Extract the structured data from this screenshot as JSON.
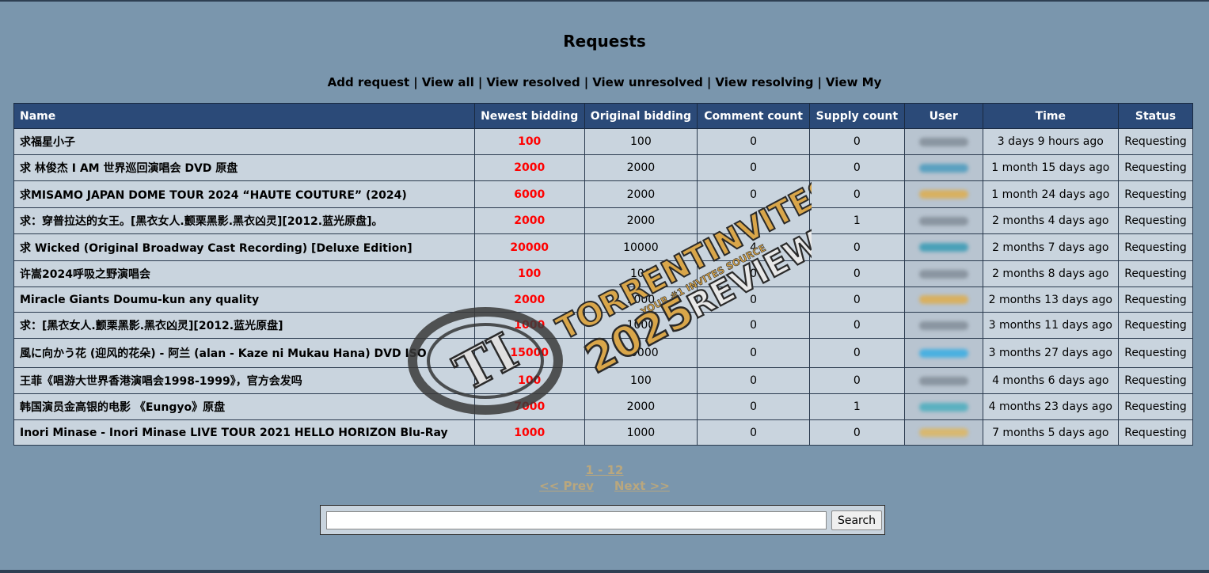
{
  "page": {
    "title": "Requests"
  },
  "nav": [
    {
      "label": "Add request"
    },
    {
      "label": "View all"
    },
    {
      "label": "View resolved"
    },
    {
      "label": "View unresolved"
    },
    {
      "label": "View resolving"
    },
    {
      "label": "View My"
    }
  ],
  "table": {
    "headers": {
      "name": "Name",
      "newest": "Newest bidding",
      "original": "Original bidding",
      "comments": "Comment count",
      "supply": "Supply count",
      "user": "User",
      "time": "Time",
      "status": "Status"
    },
    "rows": [
      {
        "name": "求福星小子",
        "newest": "100",
        "original": "100",
        "comments": "0",
        "supply": "0",
        "user_color": "#8a95a0",
        "time": "3 days 9 hours ago",
        "status": "Requesting"
      },
      {
        "name": "求 林俊杰 I AM 世界巡回演唱会 DVD 原盘",
        "newest": "2000",
        "original": "2000",
        "comments": "0",
        "supply": "0",
        "user_color": "#5aa0c0",
        "time": "1 month 15 days ago",
        "status": "Requesting"
      },
      {
        "name": "求MISAMO JAPAN DOME TOUR 2024 “HAUTE COUTURE” (2024)",
        "newest": "6000",
        "original": "2000",
        "comments": "0",
        "supply": "0",
        "user_color": "#d8b060",
        "time": "1 month 24 days ago",
        "status": "Requesting"
      },
      {
        "name": "求：穿普拉达的女王。[黑衣女人.颤栗黑影.黑衣凶灵][2012.蓝光原盘]。",
        "newest": "2000",
        "original": "2000",
        "comments": "0",
        "supply": "1",
        "user_color": "#8a95a0",
        "time": "2 months 4 days ago",
        "status": "Requesting"
      },
      {
        "name": "求 Wicked (Original Broadway Cast Recording) [Deluxe Edition]",
        "newest": "20000",
        "original": "10000",
        "comments": "4",
        "supply": "0",
        "user_color": "#4aa0b8",
        "time": "2 months 7 days ago",
        "status": "Requesting"
      },
      {
        "name": "许嵩2024呼吸之野演唱会",
        "newest": "100",
        "original": "100",
        "comments": "0",
        "supply": "0",
        "user_color": "#8a95a0",
        "time": "2 months 8 days ago",
        "status": "Requesting"
      },
      {
        "name": "Miracle Giants Doumu-kun any quality",
        "newest": "2000",
        "original": "1000",
        "comments": "0",
        "supply": "0",
        "user_color": "#d8b060",
        "time": "2 months 13 days ago",
        "status": "Requesting"
      },
      {
        "name": "求：[黑衣女人.颤栗黑影.黑衣凶灵][2012.蓝光原盘]",
        "newest": "1000",
        "original": "1000",
        "comments": "0",
        "supply": "0",
        "user_color": "#8a95a0",
        "time": "3 months 11 days ago",
        "status": "Requesting"
      },
      {
        "name": "風に向かう花 (迎风的花朵) - 阿兰 (alan - Kaze ni Mukau Hana) DVD ISO",
        "newest": "15000",
        "original": "10000",
        "comments": "0",
        "supply": "0",
        "user_color": "#4ab0e0",
        "time": "3 months 27 days ago",
        "status": "Requesting"
      },
      {
        "name": "王菲《唱游大世界香港演唱会1998-1999》，官方会发吗",
        "newest": "100",
        "original": "100",
        "comments": "0",
        "supply": "0",
        "user_color": "#8a95a0",
        "time": "4 months 6 days ago",
        "status": "Requesting"
      },
      {
        "name": "韩国演员金高银的电影 《Eungyo》原盘",
        "newest": "7000",
        "original": "2000",
        "comments": "0",
        "supply": "1",
        "user_color": "#5ab0c0",
        "time": "4 months 23 days ago",
        "status": "Requesting"
      },
      {
        "name": "Inori Minase - Inori Minase LIVE TOUR 2021 HELLO HORIZON Blu-Ray",
        "newest": "1000",
        "original": "1000",
        "comments": "0",
        "supply": "0",
        "user_color": "#d8b870",
        "time": "7 months 5 days ago",
        "status": "Requesting"
      }
    ]
  },
  "pager": {
    "range": "1 - 12",
    "prev": "<< Prev",
    "next": "Next >>"
  },
  "search": {
    "value": "",
    "placeholder": "",
    "button": "Search"
  },
  "watermark": {
    "domain": "TORRENTINVITES.ORG",
    "tagline": "YOUR #1 INVITES SOURCE",
    "year": "2025",
    "review": "REVIEW",
    "logo": "TI"
  },
  "colors": {
    "background": "#7a96ad",
    "header": "#2b4a78",
    "cell": "#c9d4de",
    "bid": "#ff0000",
    "pager": "#b9a77e"
  }
}
